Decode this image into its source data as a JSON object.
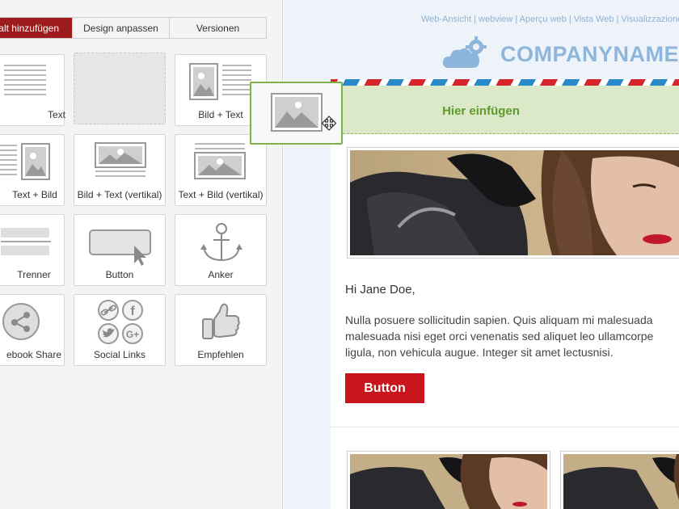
{
  "tabs": [
    {
      "label": "alt hinzufügen",
      "active": true
    },
    {
      "label": "Design anpassen",
      "active": false
    },
    {
      "label": "Versionen",
      "active": false
    }
  ],
  "tiles": {
    "text": "Text",
    "image_text": "Bild + Text",
    "text_image": "Text + Bild",
    "image_text_vertical": "Bild + Text (vertikal)",
    "text_image_vertical": "Text + Bild (vertikal)",
    "divider": "Trenner",
    "button": "Button",
    "anchor": "Anker",
    "facebook_share": "ebook Share",
    "social_links": "Social Links",
    "recommend": "Empfehlen"
  },
  "email": {
    "top_links": "Web-Ansicht | webview | Aperçu web | Vista Web | Visualizzazione w",
    "company_name": "COMPANYNAME",
    "drop_zone": "Hier einfügen",
    "greeting": "Hi Jane Doe,",
    "body_lines": [
      "Nulla posuere sollicitudin sapien. Quis aliquam mi malesuada",
      "malesuada nisi eget orci venenatis sed aliquet leo ullamcorpe",
      "ligula, non vehicula augue. Integer sit amet lectusnisi."
    ],
    "button_label": "Button"
  },
  "colors": {
    "accent_tab": "#9e1b1b",
    "button_red": "#c8141b",
    "drop_green_text": "#5e9a2e",
    "drop_green_bg": "#dbe9c8",
    "brand_blue": "#8eb6dd"
  },
  "icons": [
    "image-icon",
    "move-cursor-icon",
    "cloud-gear-logo-icon",
    "pointer-cursor-icon",
    "anchor-icon",
    "share-icon",
    "link-icon",
    "facebook-icon",
    "twitter-icon",
    "google-plus-icon",
    "thumbs-up-icon"
  ]
}
